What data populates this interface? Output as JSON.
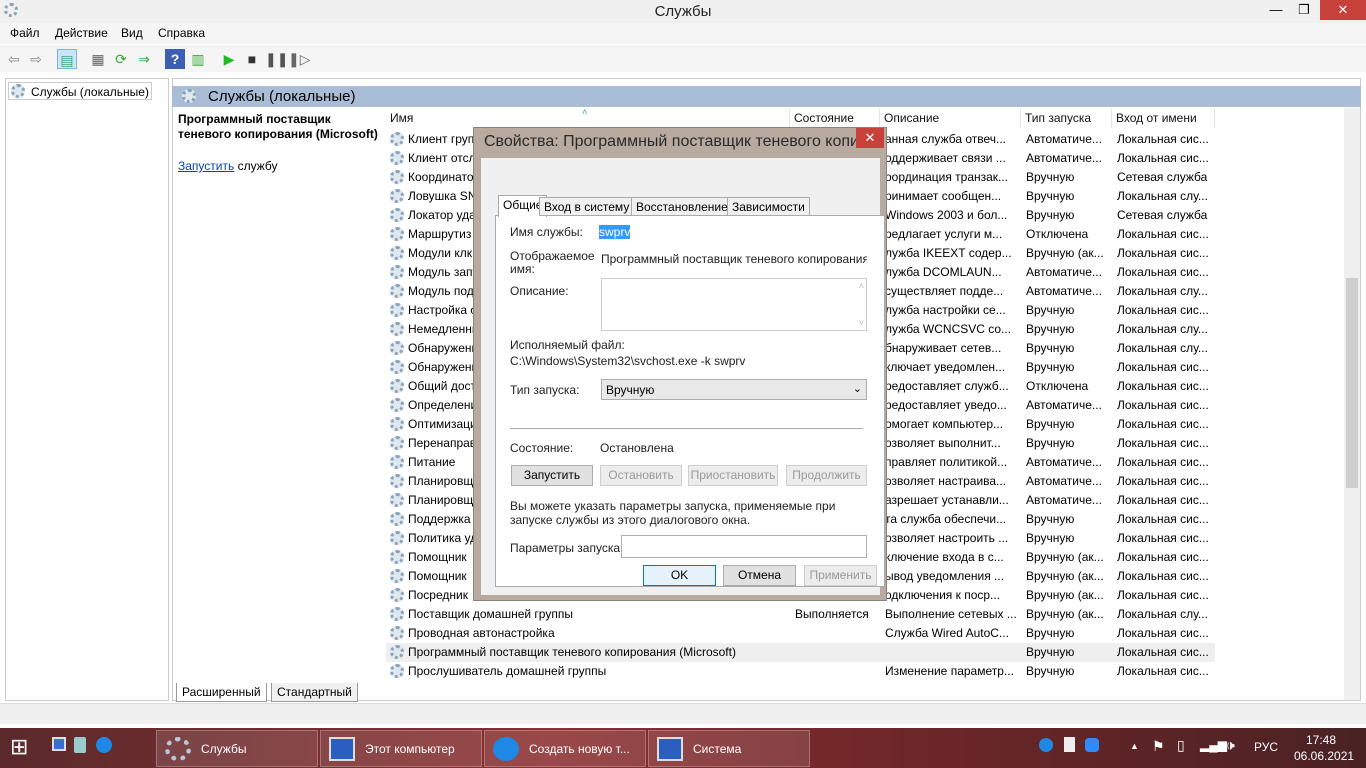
{
  "window": {
    "title": "Службы",
    "minimize": "—",
    "maximize": "❐",
    "close": "✕"
  },
  "menu": [
    "Файл",
    "Действие",
    "Вид",
    "Справка"
  ],
  "toolbar": [
    "back-icon",
    "forward-icon",
    "show-hide-console-tree-icon",
    "properties-icon",
    "refresh-icon",
    "export-list-icon",
    "help-icon",
    "action-pane-icon",
    "start-service-icon",
    "stop-service-icon",
    "pause-service-icon",
    "resume-service-icon"
  ],
  "tree": {
    "root": "Службы (локальные)"
  },
  "pane": {
    "title": "Службы (локальные)",
    "selected_name": "Программный поставщик теневого копирования (Microsoft)",
    "start_link": "Запустить",
    "start_suffix": " службу"
  },
  "columns": [
    "Имя",
    "Состояние",
    "Описание",
    "Тип запуска",
    "Вход от имени"
  ],
  "rows": [
    [
      "Клиент груп",
      "",
      "анная служба отвеч...",
      "Автоматиче...",
      "Локальная сис..."
    ],
    [
      "Клиент отсл",
      "",
      "оддерживает связи ...",
      "Автоматиче...",
      "Локальная сис..."
    ],
    [
      "Координато",
      "",
      "оординация транзак...",
      "Вручную",
      "Сетевая служба"
    ],
    [
      "Ловушка SN",
      "",
      "ринимает сообщен...",
      "Вручную",
      "Локальная слу..."
    ],
    [
      "Локатор уда",
      "",
      "Windows 2003 и бол...",
      "Вручную",
      "Сетевая служба"
    ],
    [
      "Маршрутиз",
      "",
      "редлагает услуги м...",
      "Отключена",
      "Локальная сис..."
    ],
    [
      "Модули клк",
      "",
      "лужба IKEEXT содер...",
      "Вручную (ак...",
      "Локальная сис..."
    ],
    [
      "Модуль запу",
      "",
      "лужба DCOMLAUN...",
      "Автоматиче...",
      "Локальная сис..."
    ],
    [
      "Модуль под",
      "",
      "существляет подде...",
      "Автоматиче...",
      "Локальная слу..."
    ],
    [
      "Настройка с",
      "",
      "лужба настройки се...",
      "Вручную",
      "Локальная сис..."
    ],
    [
      "Немедленны",
      "",
      "лужба WCNCSVC со...",
      "Вручную",
      "Локальная слу..."
    ],
    [
      "Обнаружени",
      "",
      "бнаруживает сетев...",
      "Вручную",
      "Локальная слу..."
    ],
    [
      "Обнаружени",
      "",
      "ключает уведомлен...",
      "Вручную",
      "Локальная сис..."
    ],
    [
      "Общий дост",
      "",
      "редоставляет служб...",
      "Отключена",
      "Локальная сис..."
    ],
    [
      "Определени",
      "",
      "редоставляет уведо...",
      "Автоматиче...",
      "Локальная сис..."
    ],
    [
      "Оптимизаци",
      "",
      "омогает компьютер...",
      "Вручную",
      "Локальная сис..."
    ],
    [
      "Перенаправ",
      "",
      "озволяет выполнит...",
      "Вручную",
      "Локальная сис..."
    ],
    [
      "Питание",
      "",
      "правляет политикой...",
      "Автоматиче...",
      "Локальная сис..."
    ],
    [
      "Планировщ",
      "",
      "озволяет настраива...",
      "Автоматиче...",
      "Локальная сис..."
    ],
    [
      "Планировщ",
      "",
      "азрешает устанавли...",
      "Автоматиче...",
      "Локальная сис..."
    ],
    [
      "Поддержка",
      "",
      "та служба обеспечи...",
      "Вручную",
      "Локальная сис..."
    ],
    [
      "Политика уд",
      "",
      "озволяет настроить ...",
      "Вручную",
      "Локальная сис..."
    ],
    [
      "Помощник",
      "",
      "ключение входа в с...",
      "Вручную (ак...",
      "Локальная сис..."
    ],
    [
      "Помощник",
      "",
      "ывод уведомления ...",
      "Вручную (ак...",
      "Локальная сис..."
    ],
    [
      "Посредник",
      "",
      "одключения к поср...",
      "Вручную (ак...",
      "Локальная сис..."
    ],
    [
      "Поставщик домашней группы",
      "Выполняется",
      "Выполнение сетевых ...",
      "Вручную (ак...",
      "Локальная слу..."
    ],
    [
      "Проводная автонастройка",
      "",
      "Служба Wired AutoC...",
      "Вручную",
      "Локальная сис..."
    ],
    [
      "Программный поставщик теневого копирования (Microsoft)",
      "",
      "",
      "Вручную",
      "Локальная сис..."
    ],
    [
      "Прослушиватель домашней группы",
      "",
      "Изменение параметр...",
      "Вручную",
      "Локальная сис..."
    ]
  ],
  "selected_row": 27,
  "bottom_tabs": [
    "Расширенный",
    "Стандартный"
  ],
  "dialog": {
    "title": "Свойства: Программный поставщик теневого копи...",
    "close": "✕",
    "tabs": [
      "Общие",
      "Вход в систему",
      "Восстановление",
      "Зависимости"
    ],
    "service_name_label": "Имя службы:",
    "service_name": "swprv",
    "display_name_label1": "Отображаемое",
    "display_name_label2": "имя:",
    "display_name": "Программный поставщик теневого копирования (Mi",
    "description_label": "Описание:",
    "description": "",
    "exe_label": "Исполняемый файл:",
    "exe_path": "C:\\Windows\\System32\\svchost.exe -k swprv",
    "startup_label": "Тип запуска:",
    "startup_value": "Вручную",
    "state_label": "Состояние:",
    "state_value": "Остановлена",
    "btn_start": "Запустить",
    "btn_stop": "Остановить",
    "btn_pause": "Приостановить",
    "btn_resume": "Продолжить",
    "hint": "Вы можете указать параметры запуска, применяемые при запуске службы из этого диалогового окна.",
    "params_label": "Параметры запуска:",
    "params_value": "",
    "ok": "OK",
    "cancel": "Отмена",
    "apply": "Применить"
  },
  "taskbar": {
    "items": [
      "Службы",
      "Этот компьютер",
      "Создать новую т...",
      "Система"
    ],
    "lang": "РУС",
    "time": "17:48",
    "date": "06.06.2021"
  }
}
